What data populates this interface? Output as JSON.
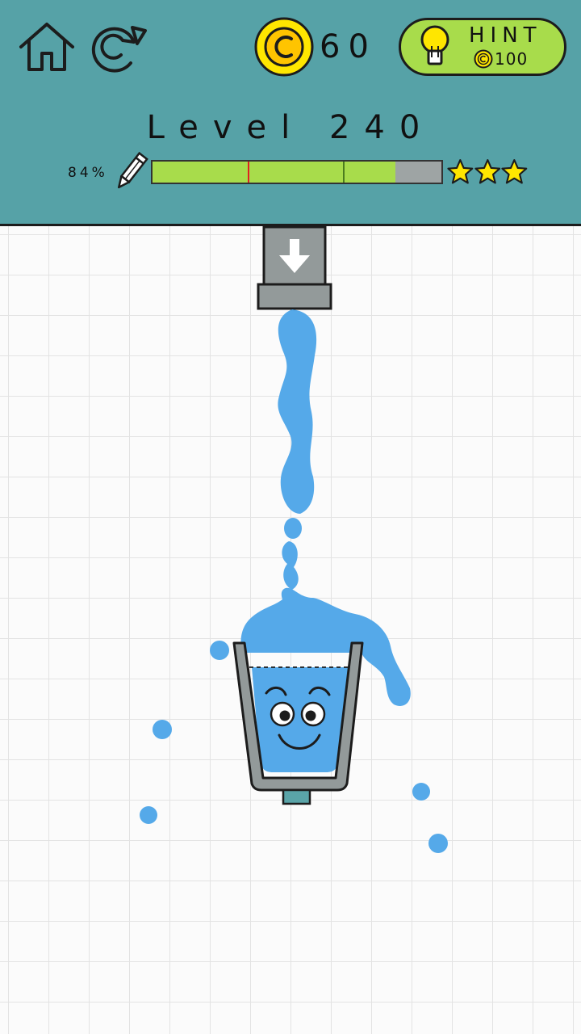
{
  "header": {
    "coins": "60",
    "hint": {
      "label": "HINT",
      "cost": "100"
    },
    "level_title": "Level 240",
    "ink": {
      "percent_label": "84%",
      "remaining_fraction": 0.84,
      "star_thresholds": [
        0.33,
        0.66
      ]
    },
    "stars_earned": 3
  },
  "icons": {
    "home": "home-icon",
    "replay": "replay-icon",
    "coin": "coin-icon",
    "hint": "lightbulb-icon",
    "pencil": "pencil-icon",
    "star": "star-icon",
    "spout_arrow": "arrow-down-icon"
  },
  "colors": {
    "header_bg": "#56a2a7",
    "accent_green": "#a8dc4b",
    "coin_yellow": "#ffe600",
    "star_yellow": "#ffe600",
    "water_blue": "#55a9e9",
    "cup_gray": "#939a9a",
    "marker_red": "#e02020"
  }
}
